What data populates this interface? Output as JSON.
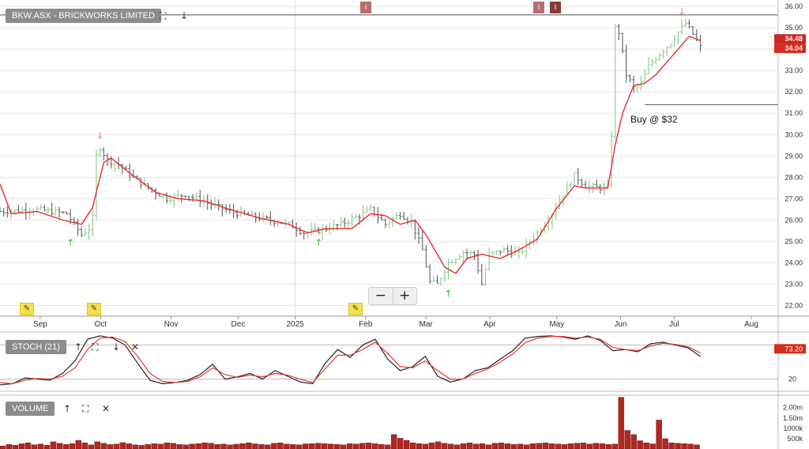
{
  "colors": {
    "up_bar": "#8fd18c",
    "down_bar": "#6b6b6b",
    "moving_average": "#ef2b2b",
    "stoch_k": "#222222",
    "stoch_d": "#e53935",
    "volume_bar": "#b3261e",
    "grid": "#e6e6e6",
    "panel_label_bg": "#8c8c8c",
    "buy_arrow": "#2fbf3a",
    "sell_arrow": "#f08080",
    "price_tag": "#d62b1e"
  },
  "panels": {
    "price": {
      "label": "BKW.ASX - BRICKWORKS LIMITED",
      "icons": [
        "expand-icon",
        "arrow-down-icon"
      ]
    },
    "stoch": {
      "label": "STOCH (21)",
      "icons": [
        "arrow-up-icon",
        "expand-icon",
        "arrow-down-icon",
        "close-icon"
      ],
      "axis_label": "20",
      "tag_value": "73.20"
    },
    "volume": {
      "label": "VOLUME",
      "icons": [
        "arrow-up-icon",
        "expand-icon",
        "close-icon"
      ]
    }
  },
  "zoom": {
    "minus": "−",
    "plus": "+"
  },
  "annotation": {
    "text": "Buy @ $32",
    "level": 31.4
  },
  "events": [
    "I",
    "I",
    "I"
  ],
  "chart_data": [
    {
      "type": "ohlc",
      "title": "BKW.ASX - BRICKWORKS LIMITED",
      "ylim": [
        21.5,
        36.3
      ],
      "y_ticks": [
        "22.00",
        "23.00",
        "24.00",
        "25.00",
        "26.00",
        "27.00",
        "28.00",
        "29.00",
        "30.00",
        "31.00",
        "32.00",
        "33.00",
        "34.00",
        "35.00",
        "36.00"
      ],
      "x_tick_labels": [
        "Sep",
        "Oct",
        "Nov",
        "Dec",
        "2025",
        "Feb",
        "Mar",
        "Apr",
        "May",
        "Jun",
        "Jul",
        "Aug"
      ],
      "last_price": "34.04",
      "ma_value": "34.48",
      "resistance_level": 35.6,
      "price_path": [
        {
          "x": 0,
          "y": 26.4
        },
        {
          "x": 10,
          "y": 26.5
        },
        {
          "x": 18,
          "y": 26.3
        },
        {
          "x": 22,
          "y": 25.3
        },
        {
          "x": 24,
          "y": 25.6
        },
        {
          "x": 25,
          "y": 26.1
        },
        {
          "x": 26,
          "y": 29.0
        },
        {
          "x": 27,
          "y": 29.4
        },
        {
          "x": 29,
          "y": 28.8
        },
        {
          "x": 32,
          "y": 28.6
        },
        {
          "x": 36,
          "y": 28.0
        },
        {
          "x": 40,
          "y": 27.5
        },
        {
          "x": 45,
          "y": 27.0
        },
        {
          "x": 50,
          "y": 27.2
        },
        {
          "x": 56,
          "y": 26.8
        },
        {
          "x": 62,
          "y": 26.4
        },
        {
          "x": 70,
          "y": 26.1
        },
        {
          "x": 78,
          "y": 25.8
        },
        {
          "x": 82,
          "y": 25.4
        },
        {
          "x": 86,
          "y": 25.5
        },
        {
          "x": 92,
          "y": 25.8
        },
        {
          "x": 97,
          "y": 26.2
        },
        {
          "x": 100,
          "y": 26.5
        },
        {
          "x": 104,
          "y": 25.8
        },
        {
          "x": 108,
          "y": 26.3
        },
        {
          "x": 111,
          "y": 25.9
        },
        {
          "x": 114,
          "y": 24.6
        },
        {
          "x": 116,
          "y": 23.1
        },
        {
          "x": 118,
          "y": 23.0
        },
        {
          "x": 121,
          "y": 24.0
        },
        {
          "x": 125,
          "y": 24.5
        },
        {
          "x": 128,
          "y": 24.4
        },
        {
          "x": 130,
          "y": 23.0
        },
        {
          "x": 132,
          "y": 24.4
        },
        {
          "x": 136,
          "y": 24.6
        },
        {
          "x": 140,
          "y": 24.4
        },
        {
          "x": 144,
          "y": 25.2
        },
        {
          "x": 148,
          "y": 26.0
        },
        {
          "x": 152,
          "y": 27.2
        },
        {
          "x": 155,
          "y": 28.1
        },
        {
          "x": 158,
          "y": 27.6
        },
        {
          "x": 162,
          "y": 27.5
        },
        {
          "x": 164,
          "y": 27.5
        },
        {
          "x": 165,
          "y": 30.0
        },
        {
          "x": 166,
          "y": 35.0
        },
        {
          "x": 167,
          "y": 34.8
        },
        {
          "x": 169,
          "y": 32.8
        },
        {
          "x": 171,
          "y": 32.2
        },
        {
          "x": 173,
          "y": 32.4
        },
        {
          "x": 175,
          "y": 33.2
        },
        {
          "x": 178,
          "y": 33.8
        },
        {
          "x": 181,
          "y": 34.3
        },
        {
          "x": 183,
          "y": 34.8
        },
        {
          "x": 185,
          "y": 35.2
        },
        {
          "x": 187,
          "y": 34.7
        },
        {
          "x": 189,
          "y": 34.1
        }
      ],
      "moving_average": [
        {
          "x": 0,
          "y": 27.7
        },
        {
          "x": 3,
          "y": 26.3
        },
        {
          "x": 10,
          "y": 26.4
        },
        {
          "x": 17,
          "y": 26.0
        },
        {
          "x": 22,
          "y": 25.8
        },
        {
          "x": 25,
          "y": 26.6
        },
        {
          "x": 28,
          "y": 28.7
        },
        {
          "x": 30,
          "y": 28.9
        },
        {
          "x": 35,
          "y": 28.2
        },
        {
          "x": 42,
          "y": 27.3
        },
        {
          "x": 48,
          "y": 27.0
        },
        {
          "x": 55,
          "y": 26.9
        },
        {
          "x": 62,
          "y": 26.5
        },
        {
          "x": 70,
          "y": 26.1
        },
        {
          "x": 78,
          "y": 25.8
        },
        {
          "x": 83,
          "y": 25.4
        },
        {
          "x": 88,
          "y": 25.6
        },
        {
          "x": 95,
          "y": 25.6
        },
        {
          "x": 100,
          "y": 26.3
        },
        {
          "x": 104,
          "y": 26.2
        },
        {
          "x": 108,
          "y": 25.8
        },
        {
          "x": 112,
          "y": 26.0
        },
        {
          "x": 115,
          "y": 25.3
        },
        {
          "x": 120,
          "y": 23.8
        },
        {
          "x": 123,
          "y": 23.5
        },
        {
          "x": 126,
          "y": 24.2
        },
        {
          "x": 130,
          "y": 24.4
        },
        {
          "x": 135,
          "y": 24.2
        },
        {
          "x": 140,
          "y": 24.6
        },
        {
          "x": 145,
          "y": 25.1
        },
        {
          "x": 150,
          "y": 26.5
        },
        {
          "x": 155,
          "y": 27.6
        },
        {
          "x": 158,
          "y": 27.5
        },
        {
          "x": 161,
          "y": 27.5
        },
        {
          "x": 164,
          "y": 27.5
        },
        {
          "x": 166,
          "y": 29.5
        },
        {
          "x": 168,
          "y": 31.0
        },
        {
          "x": 171,
          "y": 32.3
        },
        {
          "x": 174,
          "y": 32.4
        },
        {
          "x": 177,
          "y": 32.8
        },
        {
          "x": 180,
          "y": 33.4
        },
        {
          "x": 183,
          "y": 34.0
        },
        {
          "x": 186,
          "y": 34.6
        },
        {
          "x": 189,
          "y": 34.4
        }
      ],
      "markers": [
        {
          "type": "buy",
          "x": 19,
          "y": 24.8
        },
        {
          "type": "sell",
          "x": 27,
          "y": 29.8
        },
        {
          "type": "buy",
          "x": 86,
          "y": 24.8
        },
        {
          "type": "buy",
          "x": 121,
          "y": 22.4
        },
        {
          "type": "sell",
          "x": 184,
          "y": 35.6
        }
      ]
    },
    {
      "type": "line",
      "title": "STOCH (21)",
      "ylim": [
        0,
        100
      ],
      "y_ticks": [
        "20"
      ],
      "series": [
        {
          "name": "%K",
          "values": [
            10,
            12,
            22,
            20,
            18,
            30,
            52,
            90,
            96,
            92,
            80,
            48,
            18,
            12,
            14,
            18,
            28,
            46,
            20,
            24,
            30,
            20,
            35,
            25,
            15,
            12,
            48,
            72,
            58,
            80,
            90,
            55,
            35,
            42,
            60,
            25,
            15,
            20,
            35,
            40,
            55,
            70,
            92,
            95,
            96,
            94,
            90,
            96,
            88,
            70,
            72,
            68,
            82,
            85,
            80,
            75,
            60
          ]
        },
        {
          "name": "%D",
          "values": [
            14,
            12,
            18,
            21,
            20,
            25,
            40,
            72,
            92,
            94,
            86,
            60,
            30,
            16,
            14,
            16,
            24,
            40,
            28,
            23,
            27,
            24,
            30,
            27,
            20,
            14,
            38,
            62,
            62,
            72,
            85,
            65,
            42,
            40,
            52,
            35,
            20,
            20,
            30,
            38,
            50,
            64,
            84,
            92,
            95,
            95,
            92,
            94,
            90,
            76,
            72,
            70,
            78,
            83,
            81,
            77,
            66
          ]
        }
      ]
    },
    {
      "type": "bar",
      "title": "VOLUME",
      "y_ticks": [
        "500k",
        "1000k",
        "1.50m",
        "2.00m"
      ],
      "values": [
        150,
        220,
        180,
        260,
        300,
        200,
        240,
        180,
        350,
        280,
        220,
        260,
        420,
        300,
        200,
        350,
        280,
        220,
        240,
        310,
        260,
        200,
        180,
        220,
        260,
        240,
        300,
        280,
        220,
        200,
        240,
        260,
        300,
        280,
        220,
        240,
        200,
        230,
        260,
        300,
        250,
        220,
        200,
        280,
        300,
        240,
        220,
        200,
        250,
        260,
        280,
        260,
        240,
        220,
        200,
        260,
        240,
        280,
        300,
        260,
        220,
        200,
        700,
        520,
        420,
        300,
        260,
        240,
        300,
        350,
        280,
        240,
        200,
        260,
        300,
        240,
        260,
        200,
        280,
        300,
        260,
        220,
        240,
        200,
        260,
        280,
        300,
        260,
        240,
        220,
        260,
        280,
        300,
        240,
        280,
        260,
        220,
        240,
        2500,
        900,
        700,
        400,
        300,
        250,
        1400,
        500,
        300,
        280,
        260,
        240,
        200
      ]
    }
  ]
}
